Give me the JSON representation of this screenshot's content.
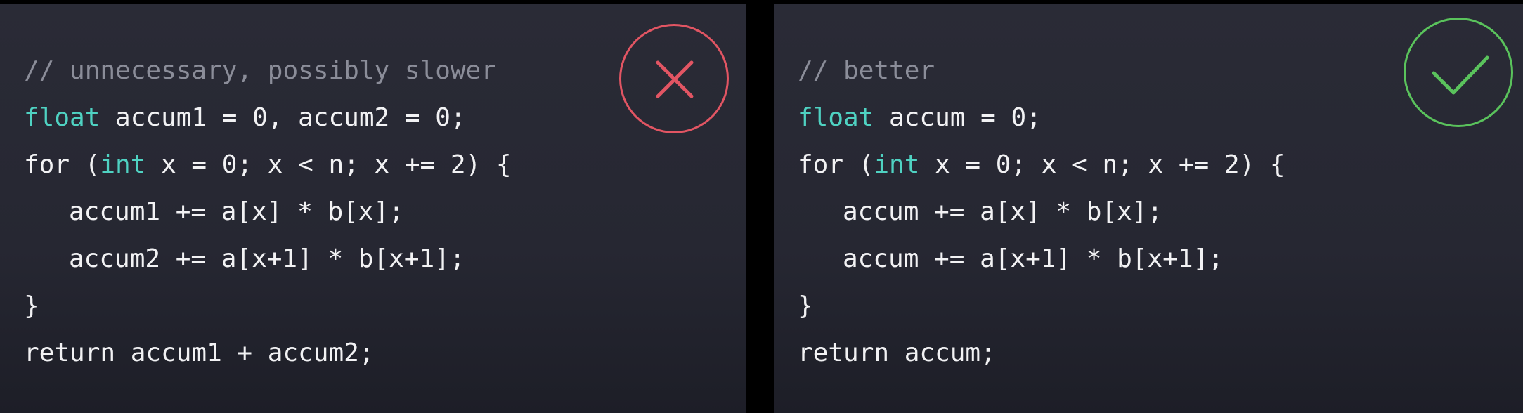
{
  "left_panel": {
    "badge_icon": "cross-icon",
    "badge_color": "#e25563",
    "lines": [
      {
        "comment": "// unnecessary, possibly slower"
      },
      {
        "kw": "float",
        "rest": " accum1 = 0, accum2 = 0;"
      },
      {
        "pre": "for (",
        "kw": "int",
        "rest": " x = 0; x < n; x += 2) {"
      },
      {
        "text": "accum1 += a[x] * b[x];"
      },
      {
        "text": "accum2 += a[x+1] * b[x+1];"
      },
      {
        "text": "}"
      },
      {
        "text": "return accum1 + accum2;"
      }
    ]
  },
  "right_panel": {
    "badge_icon": "check-icon",
    "badge_color": "#5ac35c",
    "lines": [
      {
        "comment": "// better"
      },
      {
        "kw": "float",
        "rest": " accum = 0;"
      },
      {
        "pre": "for (",
        "kw": "int",
        "rest": " x = 0; x < n; x += 2) {"
      },
      {
        "text": "accum += a[x] * b[x];"
      },
      {
        "text": "accum += a[x+1] * b[x+1];"
      },
      {
        "text": "}"
      },
      {
        "text": "return accum;"
      }
    ]
  },
  "colors": {
    "keyword": "#4fd2c2",
    "comment": "#8b8d99",
    "text": "#f2f2f4"
  }
}
